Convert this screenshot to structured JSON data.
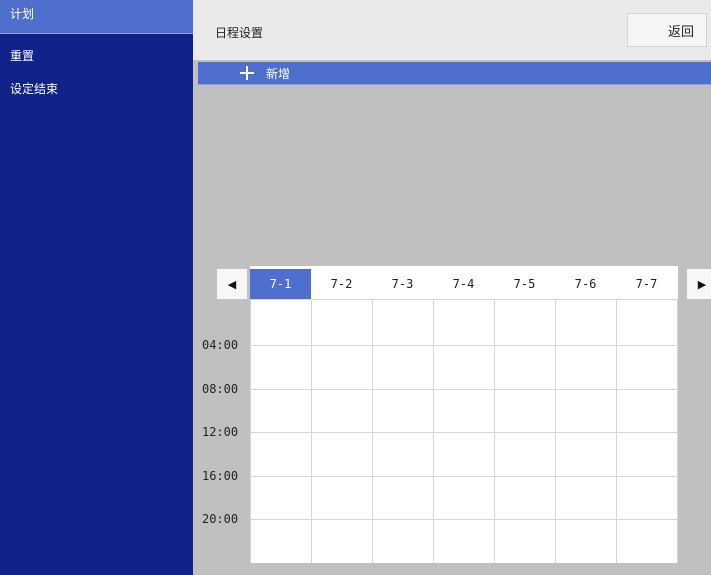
{
  "sidebar": {
    "items": [
      {
        "label": "计划",
        "active": true
      },
      {
        "label": "重置",
        "active": false
      },
      {
        "label": "设定结束",
        "active": false
      }
    ]
  },
  "header": {
    "title": "日程设置",
    "back_label": "返回"
  },
  "add_bar": {
    "icon": "plus-icon",
    "label": "新增"
  },
  "calendar": {
    "prev_icon": "triangle-left-icon",
    "next_icon": "triangle-right-icon",
    "days": [
      "7-1",
      "7-2",
      "7-3",
      "7-4",
      "7-5",
      "7-6",
      "7-7"
    ],
    "selected_day": "7-1",
    "times": [
      "04:00",
      "08:00",
      "12:00",
      "16:00",
      "20:00"
    ]
  },
  "colors": {
    "sidebar_bg": "#10238b",
    "accent": "#4f6fcf",
    "main_bg": "#c0c0c0",
    "header_bg": "#eaeaea"
  }
}
